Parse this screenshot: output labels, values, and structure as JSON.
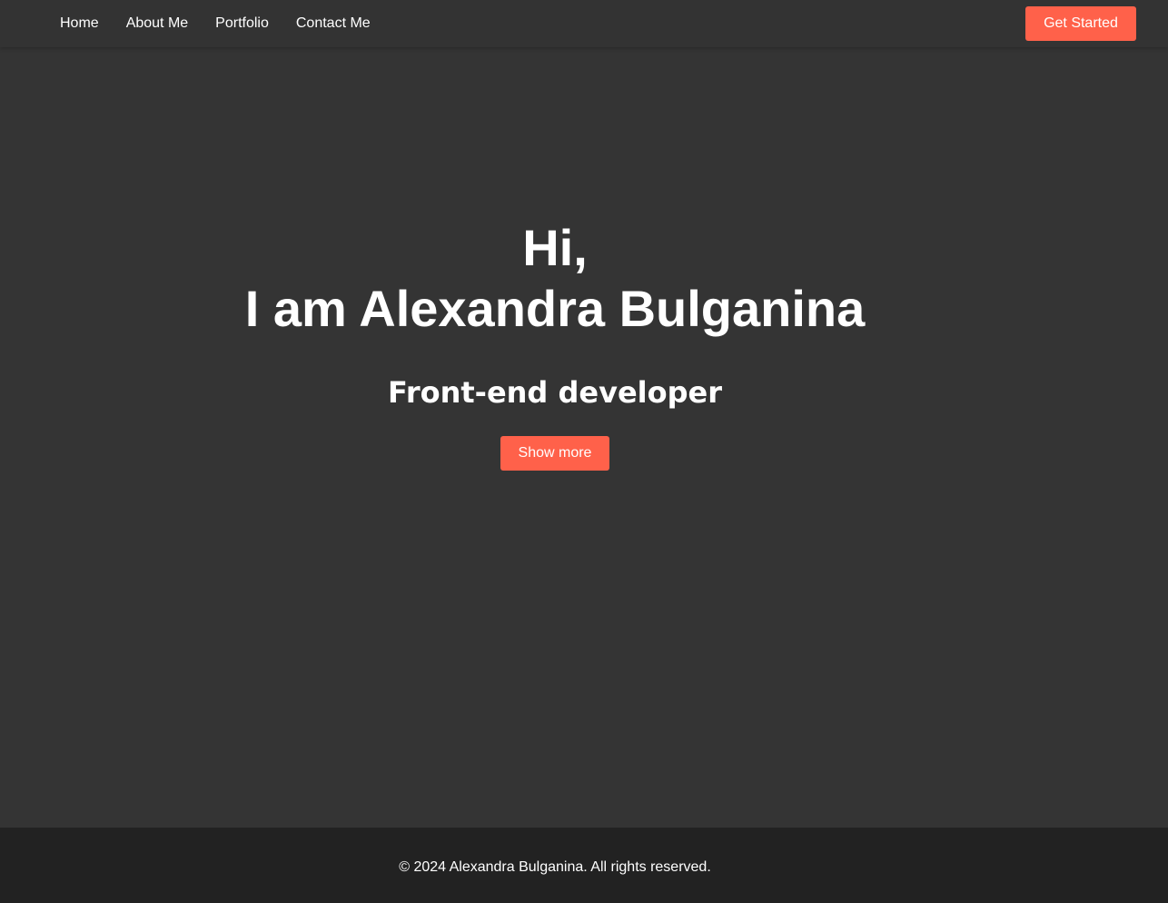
{
  "theme": {
    "page_background": "#343434",
    "navbar_background": "#333333",
    "footer_background": "#222222",
    "accent": "#FF614A",
    "text": "#FFFFFF"
  },
  "nav": {
    "items": [
      {
        "label": "Home"
      },
      {
        "label": "About Me"
      },
      {
        "label": "Portfolio"
      },
      {
        "label": "Contact Me"
      }
    ],
    "cta_label": "Get Started"
  },
  "hero": {
    "greeting": "Hi,",
    "headline": "I am Alexandra Bulganina",
    "role": "Front-end developer",
    "button_label": "Show more"
  },
  "footer": {
    "copyright": "© 2024 Alexandra Bulganina. All rights reserved."
  }
}
